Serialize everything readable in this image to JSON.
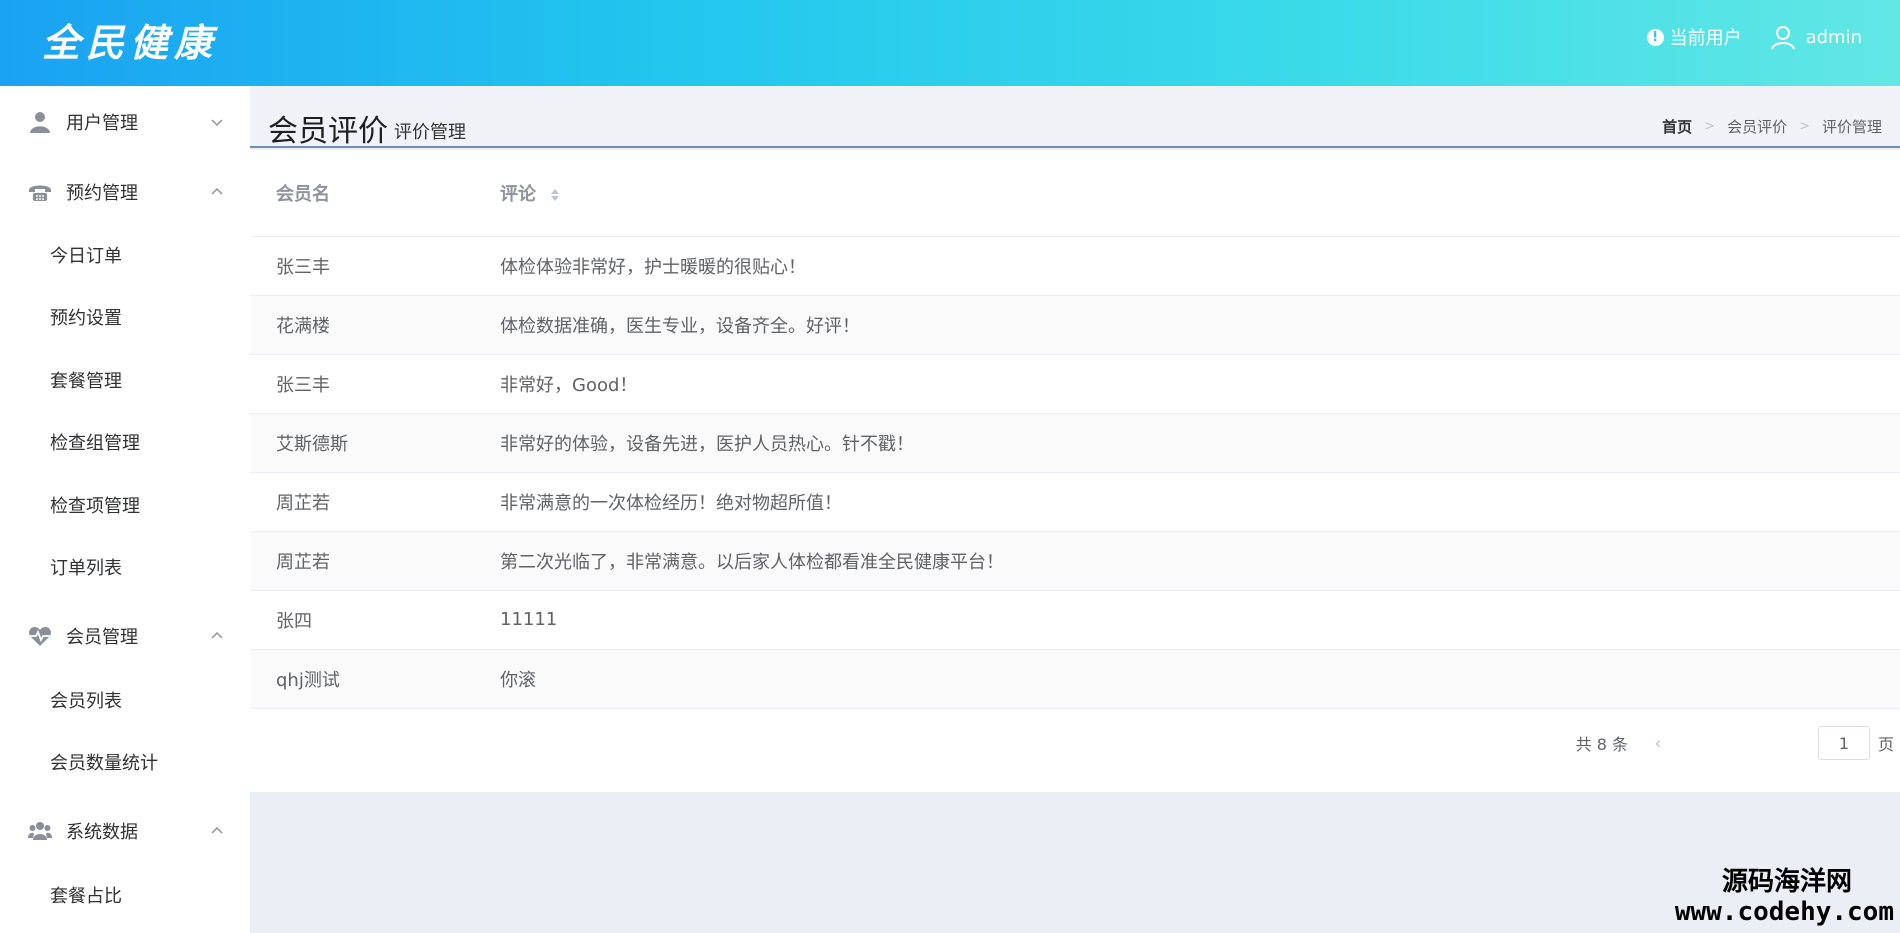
{
  "header": {
    "logo": "全民健康",
    "current_user_label": "当前用户",
    "username": "admin"
  },
  "sidebar": {
    "groups": [
      {
        "icon": "user-icon",
        "title": "用户管理",
        "expanded": false,
        "items": []
      },
      {
        "icon": "phone-icon",
        "title": "预约管理",
        "expanded": true,
        "items": [
          "今日订单",
          "预约设置",
          "套餐管理",
          "检查组管理",
          "检查项管理",
          "订单列表"
        ]
      },
      {
        "icon": "heartbeat-icon",
        "title": "会员管理",
        "expanded": true,
        "items": [
          "会员列表",
          "会员数量统计"
        ]
      },
      {
        "icon": "users-icon",
        "title": "系统数据",
        "expanded": true,
        "items": [
          "套餐占比"
        ]
      }
    ]
  },
  "page": {
    "title": "会员评价",
    "subtitle": "评价管理",
    "breadcrumb": [
      "首页",
      "会员评价",
      "评价管理"
    ]
  },
  "table": {
    "columns": [
      "会员名",
      "评论"
    ],
    "rows": [
      {
        "name": "张三丰",
        "comment": "体检体验非常好，护士暖暖的很贴心！"
      },
      {
        "name": "花满楼",
        "comment": "体检数据准确，医生专业，设备齐全。好评！"
      },
      {
        "name": "张三丰",
        "comment": "非常好，Good！"
      },
      {
        "name": "艾斯德斯",
        "comment": "非常好的体验，设备先进，医护人员热心。针不戳！"
      },
      {
        "name": "周芷若",
        "comment": "非常满意的一次体检经历！绝对物超所值！"
      },
      {
        "name": "周芷若",
        "comment": "第二次光临了，非常满意。以后家人体检都看准全民健康平台！"
      },
      {
        "name": "张四",
        "comment": "11111"
      },
      {
        "name": "qhj测试",
        "comment": "你滚"
      }
    ]
  },
  "pagination": {
    "total_text": "共 8 条",
    "page": "1",
    "page_suffix": "页"
  },
  "watermark": {
    "cn": "源码海洋网",
    "url": "www.codehy.com"
  },
  "colors": {
    "header_start": "#1aa2f2",
    "header_end": "#62e7e4",
    "title_underline": "#6e8fb6"
  }
}
